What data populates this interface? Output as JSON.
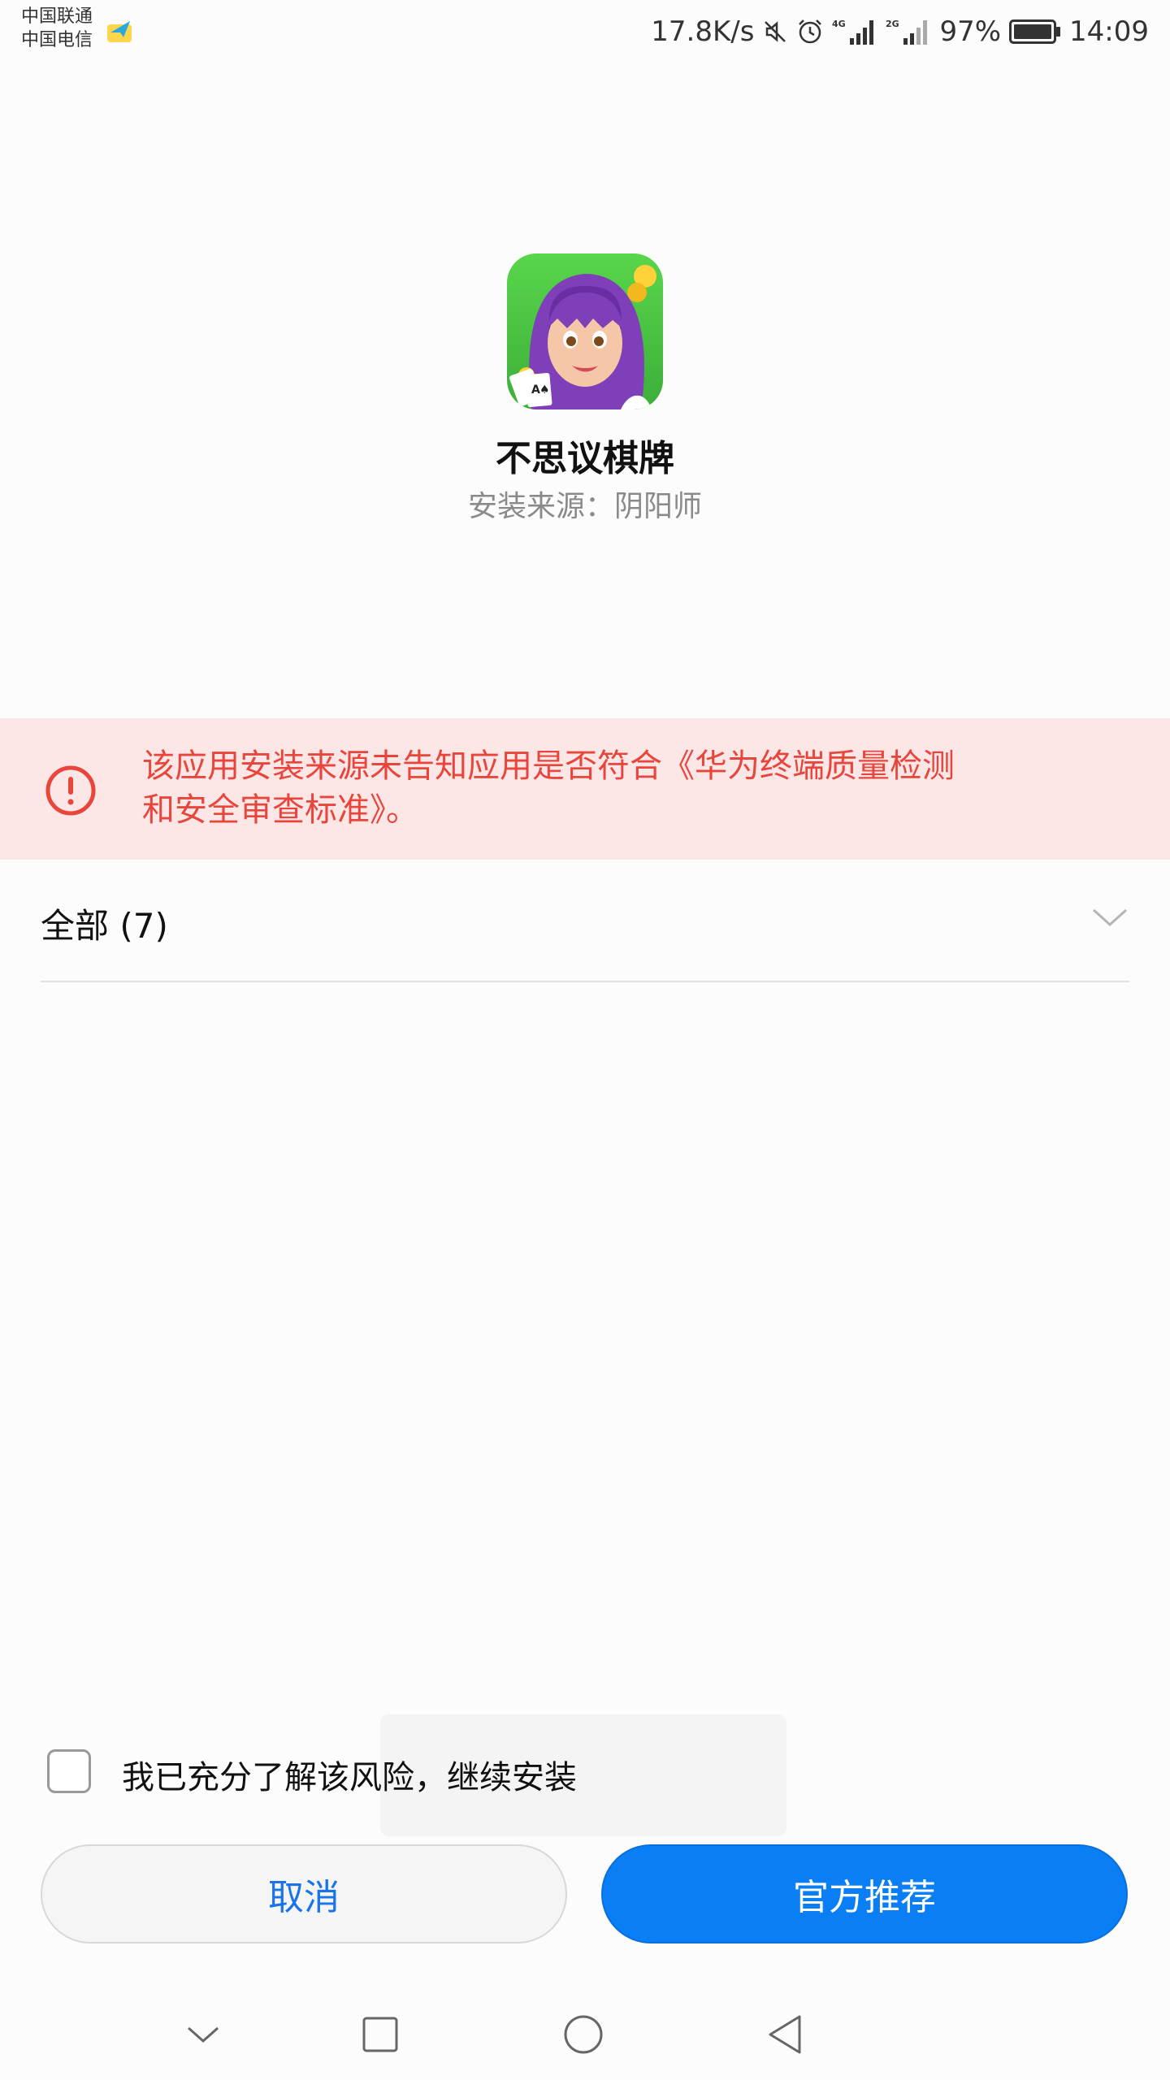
{
  "status_bar": {
    "carrier_1": "中国联通",
    "carrier_2": "中国电信",
    "network_speed": "17.8K/s",
    "signal_1_label": "4G",
    "signal_2_label": "2G",
    "battery_percent": "97%",
    "time": "14:09",
    "icons": [
      "mute-icon",
      "alarm-icon",
      "signal-4g-icon",
      "signal-2g-icon",
      "battery-icon"
    ]
  },
  "app": {
    "name": "不思议棋牌",
    "install_source": "安装来源：阴阳师"
  },
  "warning": {
    "line1": "该应用安装来源未告知应用是否符合《华为终端质量检测",
    "line2": "和安全审查标准》。",
    "color": "#e8453c",
    "background": "#fde6e6"
  },
  "permissions": {
    "label": "全部 (7)"
  },
  "confirm": {
    "label": "我已充分了解该风险，继续安装",
    "checked": false
  },
  "buttons": {
    "cancel": "取消",
    "primary": "官方推荐",
    "primary_color": "#0a7ff5"
  },
  "nav_bar": {
    "icons": [
      "nav-hide-icon",
      "nav-recents-icon",
      "nav-home-icon",
      "nav-back-icon"
    ]
  }
}
